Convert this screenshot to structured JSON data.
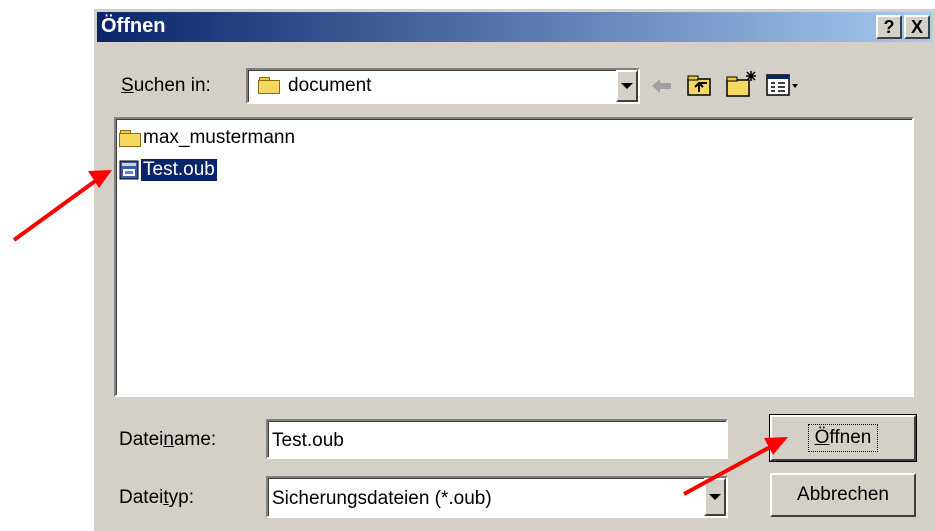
{
  "dialog": {
    "title": "Öffnen",
    "help_glyph": "?",
    "close_glyph": "X"
  },
  "look_in": {
    "label_pre": "",
    "label_u": "S",
    "label_post": "uchen in:",
    "value": "document"
  },
  "toolbar": {
    "back_icon": "back-arrow-icon",
    "up_icon": "up-folder-icon",
    "new_folder_icon": "new-folder-icon",
    "view_icon": "view-menu-icon"
  },
  "files": [
    {
      "name": "max_mustermann",
      "type": "folder",
      "selected": false
    },
    {
      "name": "Test.oub",
      "type": "file",
      "selected": true
    }
  ],
  "filename": {
    "label_pre": "Datei",
    "label_u": "n",
    "label_post": "ame:",
    "value": "Test.oub"
  },
  "filetype": {
    "label_pre": "Datei",
    "label_u": "t",
    "label_post": "yp:",
    "value": "Sicherungsdateien (*.oub)"
  },
  "buttons": {
    "open_u": "Ö",
    "open_rest": "ffnen",
    "cancel": "Abbrechen"
  },
  "colors": {
    "selection": "#0a246a",
    "annotation_arrow": "#ff0000"
  }
}
